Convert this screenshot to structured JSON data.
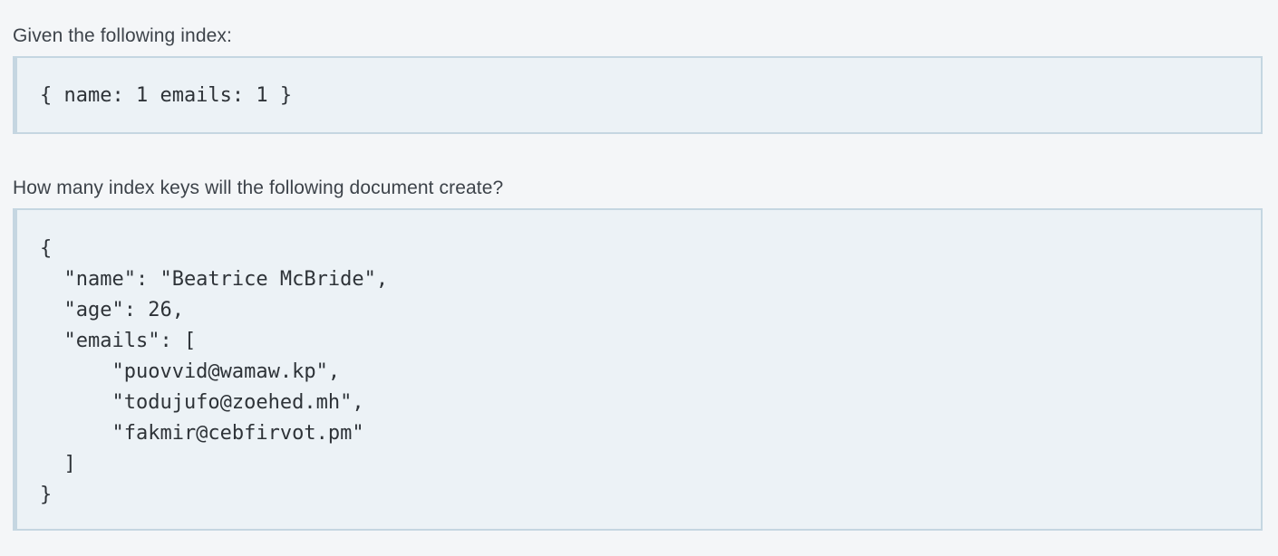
{
  "question": {
    "intro": "Given the following index:",
    "index_code": "{ name: 1 emails: 1 }",
    "prompt": "How many index keys will the following document create?",
    "document_code": "{\n  \"name\": \"Beatrice McBride\",\n  \"age\": 26,\n  \"emails\": [\n      \"puovvid@wamaw.kp\",\n      \"todujufo@zoehed.mh\",\n      \"fakmir@cebfirvot.pm\"\n  ]\n}"
  },
  "colors": {
    "page_background": "#f4f6f8",
    "code_background": "#ecf2f6",
    "code_border": "#c5d6e1",
    "text": "#3d434a"
  }
}
